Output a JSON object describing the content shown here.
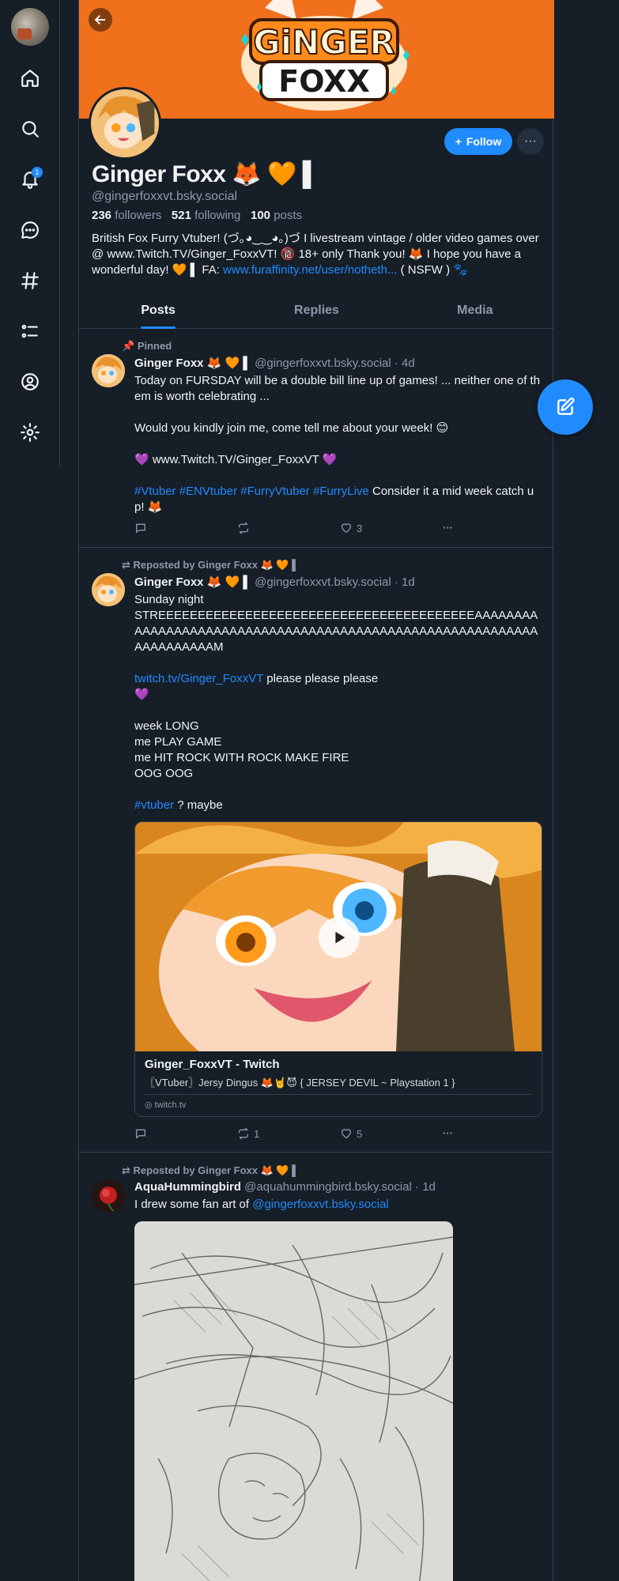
{
  "sidebar": {
    "items": [
      {
        "name": "home"
      },
      {
        "name": "search"
      },
      {
        "name": "notifications",
        "badge": "1"
      },
      {
        "name": "chat"
      },
      {
        "name": "feeds"
      },
      {
        "name": "lists"
      },
      {
        "name": "profile"
      },
      {
        "name": "settings"
      }
    ]
  },
  "banner": {
    "logo_top": "GiNGER",
    "logo_bottom": "FOXX"
  },
  "profile": {
    "display_name": "Ginger Foxx 🦊 🧡 ▌",
    "handle": "@gingerfoxxvt.bsky.social",
    "followers_count": "236",
    "followers_label": "followers",
    "following_count": "521",
    "following_label": "following",
    "posts_count": "100",
    "posts_label": "posts",
    "bio_text": "British Fox Furry Vtuber! (づ｡◕‿‿◕｡)づ I livestream vintage / older video games over @ www.Twitch.TV/Ginger_FoxxVT! 🔞 18+ only Thank you! 🦊 I hope you have a wonderful day! 🧡 ▌ FA: ",
    "bio_link": "www.furaffinity.net/user/notheth...",
    "bio_tail": " ( NSFW ) 🐾",
    "follow_label": "Follow",
    "more_label": "···"
  },
  "tabs": [
    {
      "label": "Posts"
    },
    {
      "label": "Replies"
    },
    {
      "label": "Media"
    }
  ],
  "posts": [
    {
      "context": "Pinned",
      "author": "Ginger Foxx 🦊 🧡 ▌",
      "meta": " @gingerfoxxvt.bsky.social · 4d",
      "body": "Today on FURSDAY will be a double bill line up of games! ... neither one of them is worth celebrating ...\n\nWould you kindly join me, come tell me about your week! 😊\n\n💜 www.Twitch.TV/Ginger_FoxxVT 💜\n\n",
      "tags": "#Vtuber #ENVtuber #FurryVtuber #FurryLive",
      "body_tail": " Consider it a mid week catch up! 🦊",
      "replies": "",
      "reposts": "",
      "likes": "3"
    },
    {
      "context": "Reposted by Ginger Foxx 🦊 🧡 ▌",
      "author": "Ginger Foxx 🦊 🧡 ▌",
      "meta": " @gingerfoxxvt.bsky.social · 1d",
      "body_1": "Sunday night\nSTREEEEEEEEEEEEEEEEEEEEEEEEEEEEEEEEEEEEEEEEAAAAAAAAAAAAAAAAAAAAAAAAAAAAAAAAAAAAAAAAAAAAAAAAAAAAAAAAAAAAAAAAAAAAAM\n\n",
      "link": "twitch.tv/Ginger_FoxxVT",
      "body_2": " please please please\n💜\n\nweek LONG\nme PLAY GAME\nme HIT ROCK WITH ROCK MAKE FIRE\nOOG OOG\n\n",
      "tag": "#vtuber",
      "body_3": " ? maybe",
      "embed_title": "Ginger_FoxxVT - Twitch",
      "embed_desc": "〖VTuber〗Jersy Dingus 🦊🤘😈 { JERSEY DEVIL ~ Playstation 1 }",
      "embed_domain": "twitch.tv",
      "replies": "",
      "reposts": "1",
      "likes": "5"
    },
    {
      "context": "Reposted by Ginger Foxx 🦊 🧡 ▌",
      "author": "AquaHummingbird",
      "meta": " @aquahummingbird.bsky.social · 1d",
      "body": "I drew some fan art of ",
      "mention": "@gingerfoxxvt.bsky.social"
    }
  ],
  "colors": {
    "accent": "#208bfe",
    "background": "#161e27",
    "banner": "#f0701c",
    "border": "#2e4052"
  }
}
